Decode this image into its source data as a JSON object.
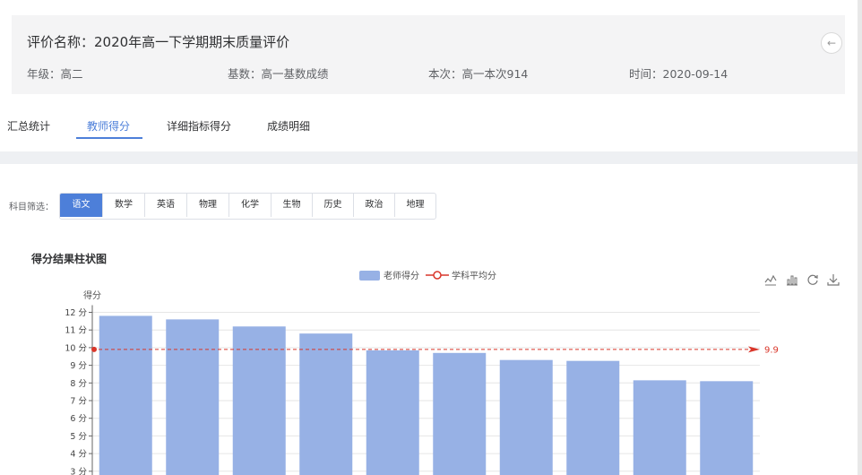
{
  "header": {
    "title": "评价名称：2020年高一下学期期末质量评价",
    "grade": "年级：高二",
    "base": "基数：高一基数成绩",
    "session": "本次：高一本次914",
    "time": "时间：2020-09-14",
    "back_icon": "arrow-left-icon"
  },
  "tabs": [
    {
      "label": "汇总统计",
      "active": false
    },
    {
      "label": "教师得分",
      "active": true
    },
    {
      "label": "详细指标得分",
      "active": false
    },
    {
      "label": "成绩明细",
      "active": false
    }
  ],
  "filter": {
    "label": "科目筛选：",
    "subjects": [
      "语文",
      "数学",
      "英语",
      "物理",
      "化学",
      "生物",
      "历史",
      "政治",
      "地理"
    ],
    "selected": "语文"
  },
  "chart_title": "得分结果柱状图",
  "toolbox": [
    "line-chart-icon",
    "bar-chart-icon",
    "refresh-icon",
    "download-icon"
  ],
  "colors": {
    "accent": "#4d7fd9",
    "bar": "#97b1e5",
    "avg_line": "#d9362a"
  },
  "chart_data": {
    "type": "bar",
    "ylabel": "得分",
    "y_ticks": [
      "12 分",
      "11 分",
      "10 分",
      "9 分",
      "8 分",
      "7 分",
      "6 分",
      "5 分",
      "4 分",
      "3 分"
    ],
    "ylim": [
      3,
      12
    ],
    "legend": {
      "bar": "老师得分",
      "line": "学科平均分"
    },
    "legend_position": "top-center",
    "values": [
      11.8,
      11.6,
      11.2,
      10.8,
      9.85,
      9.7,
      9.3,
      9.25,
      8.15,
      8.1
    ],
    "average": 9.9,
    "average_label": "9.9",
    "grid": true
  }
}
